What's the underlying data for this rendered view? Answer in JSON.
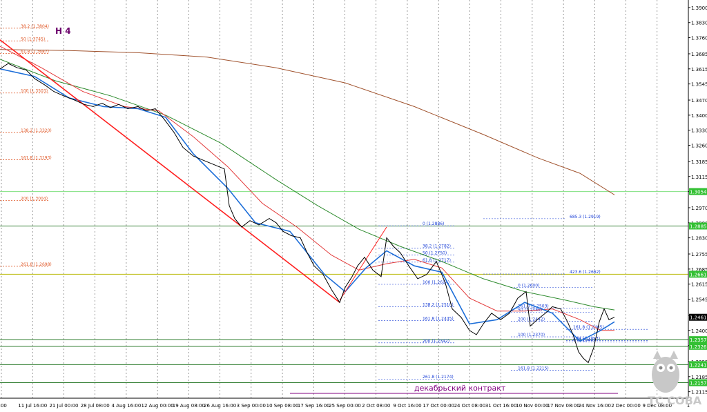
{
  "timeframe_label": "H 4",
  "contract_label": "декабрьский контракт",
  "watermark_text": "TC COBA",
  "colors": {
    "price": "#000000",
    "ma_fast": "#1e6fd9",
    "ma_mid": "#e33b3b",
    "ma_slow": "#2e8b2e",
    "ma_long": "#a0522d",
    "trend": "#ff2020",
    "fibo": "#e05a2a",
    "fibo_blue": "#1a3fd6",
    "grid": "#555555",
    "hline_green": "#2a7a2a",
    "hline_lime": "#7fe07f",
    "hline_olive": "#b8b800",
    "axis_tag_green": "#33c033",
    "contract_line": "#800080",
    "current_tag": "#000000"
  },
  "chart_data": {
    "type": "line",
    "title": "",
    "ylim": [
      1.2085,
      1.3935
    ],
    "y_ticks": [
      "1.3900",
      "1.3830",
      "1.3760",
      "1.3685",
      "1.3615",
      "1.3545",
      "1.3470",
      "1.3400",
      "1.3330",
      "1.3260",
      "1.3185",
      "1.3115",
      "1.3045",
      "1.2970",
      "1.2900",
      "1.2830",
      "1.2755",
      "1.2685",
      "1.2615",
      "1.2545",
      "1.2470",
      "1.2400",
      "1.2330",
      "1.2255",
      "1.2185",
      "1.2115"
    ],
    "x_tick_labels": [
      "8:00",
      "11 Jul 16:00",
      "21 Jul 00:00",
      "28 Jul 08:00",
      "4 Aug 16:00",
      "12 Aug 00:00",
      "19 Aug 08:00",
      "26 Aug 16:00",
      "3 Sep 00:00",
      "10 Sep 08:00",
      "17 Sep 16:00",
      "25 Sep 00:00",
      "2 Oct 08:00",
      "9 Oct 16:00",
      "17 Oct 00:00",
      "24 Oct 08:00",
      "31 Oct 16:00",
      "10 Nov 00:00",
      "17 Nov 08:00",
      "24 Nov 16:00",
      "2 Dec 00:00",
      "9 Dec 08:00",
      "1"
    ],
    "price_points": [
      [
        0,
        1.3615
      ],
      [
        12,
        1.364
      ],
      [
        25,
        1.362
      ],
      [
        38,
        1.361
      ],
      [
        50,
        1.357
      ],
      [
        65,
        1.354
      ],
      [
        78,
        1.351
      ],
      [
        92,
        1.349
      ],
      [
        108,
        1.347
      ],
      [
        122,
        1.345
      ],
      [
        135,
        1.344
      ],
      [
        148,
        1.3455
      ],
      [
        160,
        1.3435
      ],
      [
        172,
        1.345
      ],
      [
        185,
        1.343
      ],
      [
        200,
        1.344
      ],
      [
        212,
        1.342
      ],
      [
        225,
        1.343
      ],
      [
        238,
        1.338
      ],
      [
        252,
        1.332
      ],
      [
        265,
        1.325
      ],
      [
        280,
        1.321
      ],
      [
        295,
        1.319
      ],
      [
        310,
        1.317
      ],
      [
        325,
        1.315
      ],
      [
        332,
        1.298
      ],
      [
        340,
        1.292
      ],
      [
        350,
        1.288
      ],
      [
        362,
        1.291
      ],
      [
        375,
        1.289
      ],
      [
        390,
        1.292
      ],
      [
        400,
        1.29
      ],
      [
        410,
        1.286
      ],
      [
        422,
        1.284
      ],
      [
        435,
        1.283
      ],
      [
        445,
        1.276
      ],
      [
        455,
        1.27
      ],
      [
        468,
        1.266
      ],
      [
        480,
        1.259
      ],
      [
        492,
        1.253
      ],
      [
        500,
        1.26
      ],
      [
        510,
        1.265
      ],
      [
        518,
        1.27
      ],
      [
        528,
        1.274
      ],
      [
        540,
        1.268
      ],
      [
        552,
        1.265
      ],
      [
        560,
        1.283
      ],
      [
        570,
        1.279
      ],
      [
        580,
        1.276
      ],
      [
        592,
        1.27
      ],
      [
        605,
        1.264
      ],
      [
        618,
        1.266
      ],
      [
        632,
        1.272
      ],
      [
        645,
        1.262
      ],
      [
        655,
        1.25
      ],
      [
        668,
        1.246
      ],
      [
        680,
        1.24
      ],
      [
        690,
        1.238
      ],
      [
        700,
        1.243
      ],
      [
        712,
        1.248
      ],
      [
        725,
        1.245
      ],
      [
        738,
        1.248
      ],
      [
        750,
        1.255
      ],
      [
        762,
        1.258
      ],
      [
        768,
        1.242
      ],
      [
        778,
        1.245
      ],
      [
        790,
        1.248
      ],
      [
        800,
        1.251
      ],
      [
        812,
        1.25
      ],
      [
        822,
        1.244
      ],
      [
        830,
        1.238
      ],
      [
        838,
        1.23
      ],
      [
        845,
        1.227
      ],
      [
        852,
        1.225
      ],
      [
        860,
        1.232
      ],
      [
        868,
        1.244
      ],
      [
        875,
        1.25
      ],
      [
        882,
        1.245
      ],
      [
        890,
        1.2461
      ]
    ],
    "ma_fast": [
      [
        0,
        1.3615
      ],
      [
        50,
        1.358
      ],
      [
        100,
        1.348
      ],
      [
        150,
        1.344
      ],
      [
        200,
        1.343
      ],
      [
        240,
        1.339
      ],
      [
        280,
        1.322
      ],
      [
        330,
        1.306
      ],
      [
        370,
        1.29
      ],
      [
        420,
        1.286
      ],
      [
        470,
        1.266
      ],
      [
        500,
        1.258
      ],
      [
        530,
        1.269
      ],
      [
        560,
        1.277
      ],
      [
        600,
        1.27
      ],
      [
        640,
        1.267
      ],
      [
        680,
        1.243
      ],
      [
        720,
        1.245
      ],
      [
        760,
        1.253
      ],
      [
        800,
        1.248
      ],
      [
        840,
        1.235
      ],
      [
        870,
        1.24
      ],
      [
        890,
        1.244
      ]
    ],
    "ma_mid": [
      [
        0,
        1.372
      ],
      [
        60,
        1.362
      ],
      [
        120,
        1.351
      ],
      [
        180,
        1.344
      ],
      [
        230,
        1.342
      ],
      [
        280,
        1.33
      ],
      [
        330,
        1.316
      ],
      [
        380,
        1.299
      ],
      [
        430,
        1.288
      ],
      [
        480,
        1.275
      ],
      [
        520,
        1.268
      ],
      [
        560,
        1.271
      ],
      [
        600,
        1.273
      ],
      [
        640,
        1.269
      ],
      [
        680,
        1.255
      ],
      [
        720,
        1.249
      ],
      [
        760,
        1.249
      ],
      [
        800,
        1.25
      ],
      [
        840,
        1.245
      ],
      [
        870,
        1.24
      ],
      [
        890,
        1.24
      ]
    ],
    "ma_slow": [
      [
        0,
        1.366
      ],
      [
        80,
        1.356
      ],
      [
        160,
        1.349
      ],
      [
        240,
        1.34
      ],
      [
        320,
        1.327
      ],
      [
        400,
        1.31
      ],
      [
        460,
        1.298
      ],
      [
        520,
        1.287
      ],
      [
        580,
        1.279
      ],
      [
        640,
        1.272
      ],
      [
        700,
        1.264
      ],
      [
        760,
        1.258
      ],
      [
        820,
        1.254
      ],
      [
        860,
        1.251
      ],
      [
        890,
        1.2495
      ]
    ],
    "ma_long": [
      [
        0,
        1.3705
      ],
      [
        100,
        1.37
      ],
      [
        200,
        1.369
      ],
      [
        300,
        1.367
      ],
      [
        400,
        1.362
      ],
      [
        500,
        1.355
      ],
      [
        600,
        1.344
      ],
      [
        700,
        1.331
      ],
      [
        780,
        1.32
      ],
      [
        840,
        1.313
      ],
      [
        890,
        1.303
      ]
    ],
    "trend_line": [
      [
        0,
        1.375
      ],
      [
        492,
        1.253
      ]
    ],
    "trend_line_2": [
      [
        492,
        1.254
      ],
      [
        560,
        1.288
      ]
    ],
    "levels": [
      {
        "value": 1.3045,
        "label": "1.3054",
        "style": "lime"
      },
      {
        "value": 1.2885,
        "label": "1.2885",
        "style": "green"
      },
      {
        "value": 1.2661,
        "label": "1.2661",
        "style": "olive"
      },
      {
        "value": 1.2357,
        "label": "1.2357",
        "style": "green"
      },
      {
        "value": 1.2326,
        "label": "1.2326",
        "style": "green"
      },
      {
        "value": 1.2241,
        "label": "1.2241",
        "style": "green"
      },
      {
        "value": 1.2157,
        "label": "1.2157",
        "style": "green"
      }
    ],
    "current_price": "1.2461",
    "fibo_left": [
      {
        "label": "38.2 (1.3804)",
        "value": 1.3804
      },
      {
        "label": "50 (1.3745)",
        "value": 1.3745
      },
      {
        "label": "61.8 (1.3687)",
        "value": 1.3687
      },
      {
        "label": "100 (1.3503)",
        "value": 1.3503
      },
      {
        "label": "138.2 (1.3320)",
        "value": 1.332
      },
      {
        "label": "161.8 (1.3193)",
        "value": 1.3193
      },
      {
        "label": "200 (1.3004)",
        "value": 1.3004
      },
      {
        "label": "261.8 (1.2698)",
        "value": 1.2698
      }
    ],
    "fibo_right_upper": [
      {
        "label": "0 (1.2886)",
        "value": 1.2886
      },
      {
        "label": "38.2 (1.2782)",
        "value": 1.2782
      },
      {
        "label": "50 (1.2750)",
        "value": 1.275
      },
      {
        "label": "61.8 (1.2717)",
        "value": 1.2717
      },
      {
        "label": "100 (1.2614)",
        "value": 1.2614
      },
      {
        "label": "138.2 (1.2510)",
        "value": 1.251
      },
      {
        "label": "161.8 (1.2445)",
        "value": 1.2445
      },
      {
        "label": "200 (1.2342)",
        "value": 1.2342
      },
      {
        "label": "261.8 (1.2174)",
        "value": 1.2174
      }
    ],
    "fibo_right_lower": [
      {
        "label": "685.3 (1.2919)",
        "value": 1.2919
      },
      {
        "label": "423.6 (1.2662)",
        "value": 1.2662
      },
      {
        "label": "0 (1.2600)",
        "value": 1.26
      },
      {
        "label": "261.8 (1.2503)",
        "value": 1.2503
      },
      {
        "label": "50 (1.2485)",
        "value": 1.2485
      },
      {
        "label": "200 (1.2442)",
        "value": 1.2442
      },
      {
        "label": "100 (1.2370)",
        "value": 1.237
      },
      {
        "label": "161.8 (1.2215)",
        "value": 1.2215
      },
      {
        "label": "161.8 (1.2405)",
        "value": 1.2405
      },
      {
        "label": "100 (1.2353)",
        "value": 1.2353
      },
      {
        "label": "0 (1.2346)",
        "value": 1.2346
      }
    ]
  }
}
